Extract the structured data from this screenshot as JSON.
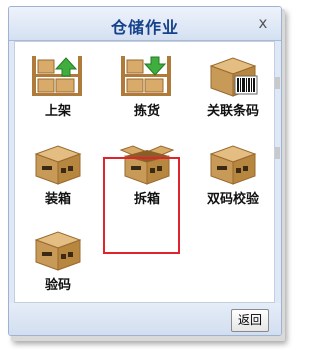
{
  "window": {
    "title": "仓储作业",
    "close_glyph": "x"
  },
  "tiles": [
    {
      "label": "上架",
      "icon": "shelf-up-arrow-icon"
    },
    {
      "label": "拣货",
      "icon": "shelf-down-arrow-icon"
    },
    {
      "label": "关联条码",
      "icon": "box-barcode-icon"
    },
    {
      "label": "装箱",
      "icon": "box-icon"
    },
    {
      "label": "拆箱",
      "icon": "open-box-icon"
    },
    {
      "label": "双码校验",
      "icon": "box-icon"
    },
    {
      "label": "验码",
      "icon": "box-icon"
    }
  ],
  "footer": {
    "back_label": "返回"
  },
  "colors": {
    "title": "#15428b",
    "highlight": "#e0242b",
    "box": "#c89a58",
    "arrow": "#3fae3f"
  }
}
